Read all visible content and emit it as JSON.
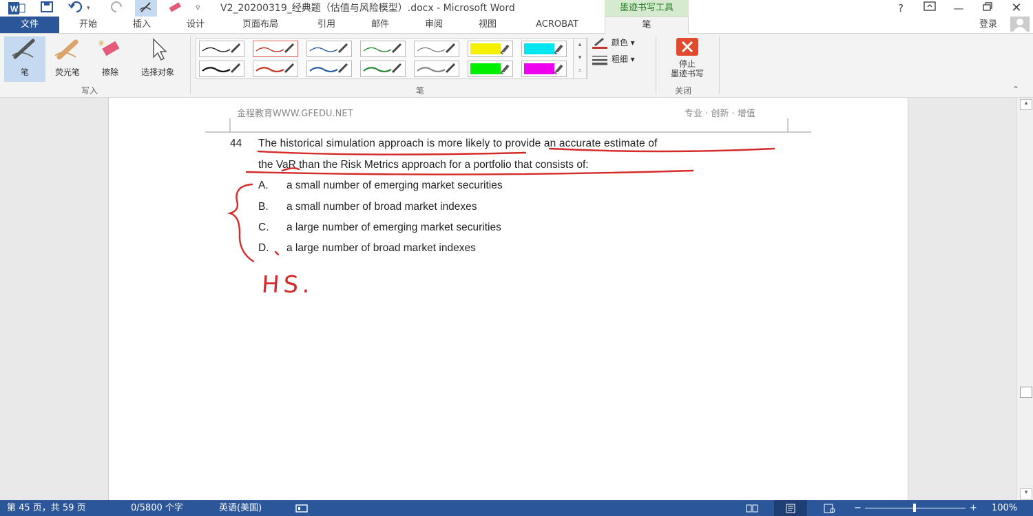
{
  "app": {
    "title": "V2_20200319_经典题（估值与风险模型）.docx - Microsoft Word",
    "contextual_tab": "墨迹书写工具",
    "login": "登录",
    "help": "?"
  },
  "tabs": [
    "文件",
    "开始",
    "插入",
    "设计",
    "页面布局",
    "引用",
    "邮件",
    "审阅",
    "视图",
    "ACROBAT",
    "笔"
  ],
  "ribbon": {
    "write_group": {
      "label": "写入",
      "buttons": [
        "笔",
        "荧光笔",
        "擦除",
        "选择对象"
      ]
    },
    "pens_group": {
      "label": "笔",
      "color_label": "颜色",
      "weight_label": "粗细"
    },
    "close_group": {
      "label": "关闭",
      "stop_label_1": "停止",
      "stop_label_2": "墨迹书写"
    },
    "pen_colors": {
      "row1": [
        "#222222",
        "#c0392b",
        "#2e5fa8",
        "#2e8b3a",
        "#888888",
        "#f5f000",
        "#00e5f0"
      ],
      "row2": [
        "#111111",
        "#c0392b",
        "#2e5fa8",
        "#2e8b3a",
        "#888888",
        "#00ee00",
        "#ee00ee"
      ]
    }
  },
  "document": {
    "header_left": "金程教育WWW.GFEDU.NET",
    "header_right": "专业 · 创新 · 增值",
    "question_number": "44",
    "question_line1": "The historical simulation approach is more likely to provide an accurate estimate of",
    "question_line2": "the VaR than the Risk Metrics approach for a portfolio that consists of:",
    "options": [
      {
        "letter": "A.",
        "text": "a small number of emerging market securities"
      },
      {
        "letter": "B.",
        "text": "a small number of broad market indexes"
      },
      {
        "letter": "C.",
        "text": "a large number of emerging market securities"
      },
      {
        "letter": "D.",
        "text": "a large number of broad market indexes"
      }
    ],
    "handwritten_note": "HS."
  },
  "status": {
    "page": "第 45 页，共 59 页",
    "words": "0/5800 个字",
    "language": "英语(美国)",
    "zoom": "100%"
  }
}
